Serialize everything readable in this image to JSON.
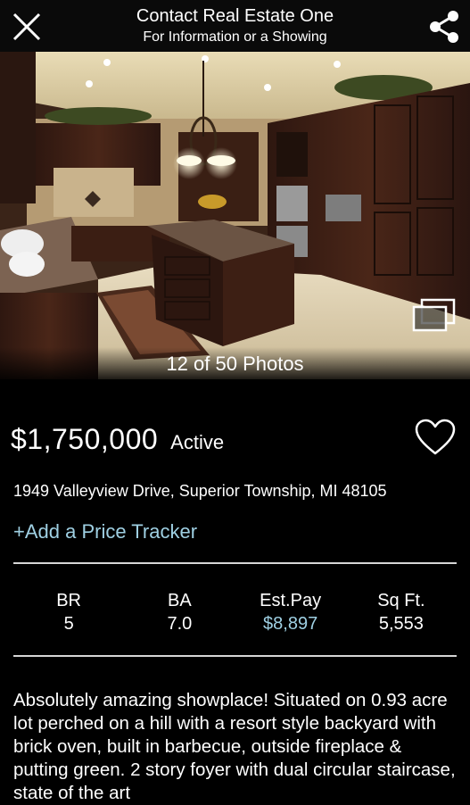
{
  "header": {
    "title": "Contact Real Estate One",
    "subtitle": "For Information or a Showing",
    "close_icon": "close-icon",
    "share_icon": "share-icon"
  },
  "photo": {
    "counter": "12 of 50 Photos",
    "gallery_icon": "gallery-icon"
  },
  "listing": {
    "price": "$1,750,000",
    "status": "Active",
    "favorite_icon": "heart-icon",
    "address": "1949 Valleyview Drive, Superior Township, MI 48105",
    "price_tracker": "+Add a Price Tracker"
  },
  "stats": [
    {
      "label": "BR",
      "value": "5"
    },
    {
      "label": "BA",
      "value": "7.0"
    },
    {
      "label": "Est.Pay",
      "value": "$8,897"
    },
    {
      "label": "Sq Ft.",
      "value": "5,553"
    }
  ],
  "description": "Absolutely amazing showplace!  Situated on 0.93 acre lot perched on a hill with a resort style backyard  with brick oven, built in barbecue, outside fireplace & putting green.  2 story foyer with dual circular staircase, state of the art",
  "colors": {
    "background": "#000000",
    "link": "#9fd0e3",
    "divider": "#d6d6d6"
  }
}
